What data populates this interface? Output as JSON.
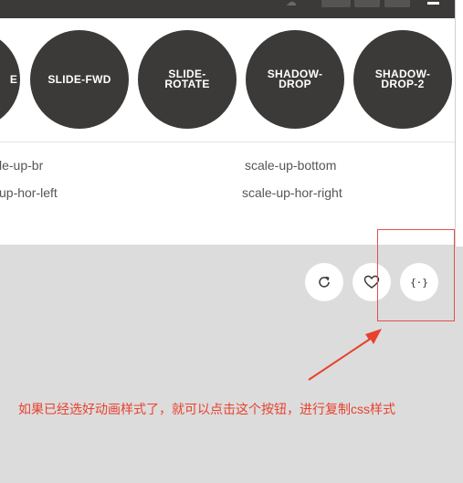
{
  "colors": {
    "topbar": "#3b3a39",
    "circle": "#3b3a39",
    "panel": "#ffffff",
    "workspace": "#dcdcdc",
    "annotation": "#e8412e"
  },
  "topbar": {
    "faded_label": "☁",
    "menu_icon": "menu-icon"
  },
  "animations": [
    {
      "label": "E"
    },
    {
      "label": "SLIDE-FWD"
    },
    {
      "label": "SLIDE-ROTATE"
    },
    {
      "label": "SHADOW-DROP"
    },
    {
      "label": "SHADOW-DROP-2"
    }
  ],
  "options": {
    "row1": [
      "le-up-br",
      "scale-up-bottom"
    ],
    "row2": [
      "up-hor-left",
      "scale-up-hor-right"
    ]
  },
  "actions": [
    {
      "name": "replay",
      "icon": "refresh-icon"
    },
    {
      "name": "favorite",
      "icon": "heart-icon"
    },
    {
      "name": "get-code",
      "icon": "code-braces-icon",
      "label": "{·}"
    }
  ],
  "annotation": {
    "note": "如果已经选好动画样式了，就可以点击这个按钮，进行复制css样式"
  }
}
